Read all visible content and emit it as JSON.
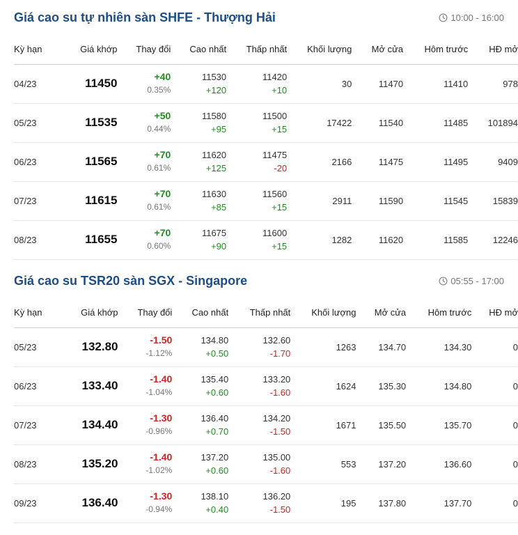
{
  "colors": {
    "title": "#1d4e89",
    "up": "#1e8f1e",
    "down": "#d22323"
  },
  "shfe": {
    "title": "Giá cao su tự nhiên sàn SHFE - Thượng Hải",
    "time_icon": "clock-icon",
    "time": "10:00 - 16:00",
    "headers": [
      "Kỳ hạn",
      "Giá khớp",
      "Thay đổi",
      "Cao nhất",
      "Thấp nhất",
      "Khối lượng",
      "Mở cửa",
      "Hôm trước",
      "HĐ mở"
    ],
    "rows": [
      {
        "term": "04/23",
        "price": "11450",
        "change": "+40",
        "change_pct": "0.35%",
        "dir": "up",
        "high": "11530",
        "high_chg": "+120",
        "high_dir": "up",
        "low": "11420",
        "low_chg": "+10",
        "low_dir": "up",
        "volume": "30",
        "open": "11470",
        "prev": "11410",
        "oi": "978"
      },
      {
        "term": "05/23",
        "price": "11535",
        "change": "+50",
        "change_pct": "0.44%",
        "dir": "up",
        "high": "11580",
        "high_chg": "+95",
        "high_dir": "up",
        "low": "11500",
        "low_chg": "+15",
        "low_dir": "up",
        "volume": "17422",
        "open": "11540",
        "prev": "11485",
        "oi": "101894"
      },
      {
        "term": "06/23",
        "price": "11565",
        "change": "+70",
        "change_pct": "0.61%",
        "dir": "up",
        "high": "11620",
        "high_chg": "+125",
        "high_dir": "up",
        "low": "11475",
        "low_chg": "-20",
        "low_dir": "down",
        "volume": "2166",
        "open": "11475",
        "prev": "11495",
        "oi": "9409"
      },
      {
        "term": "07/23",
        "price": "11615",
        "change": "+70",
        "change_pct": "0.61%",
        "dir": "up",
        "high": "11630",
        "high_chg": "+85",
        "high_dir": "up",
        "low": "11560",
        "low_chg": "+15",
        "low_dir": "up",
        "volume": "2911",
        "open": "11590",
        "prev": "11545",
        "oi": "15839"
      },
      {
        "term": "08/23",
        "price": "11655",
        "change": "+70",
        "change_pct": "0.60%",
        "dir": "up",
        "high": "11675",
        "high_chg": "+90",
        "high_dir": "up",
        "low": "11600",
        "low_chg": "+15",
        "low_dir": "up",
        "volume": "1282",
        "open": "11620",
        "prev": "11585",
        "oi": "12246"
      }
    ]
  },
  "sgx": {
    "title": "Giá cao su TSR20 sàn SGX - Singapore",
    "time_icon": "clock-icon",
    "time": "05:55 - 17:00",
    "headers": [
      "Kỳ hạn",
      "Giá khớp",
      "Thay đổi",
      "Cao nhất",
      "Thấp nhất",
      "Khối lượng",
      "Mở cửa",
      "Hôm trước",
      "HĐ mở"
    ],
    "rows": [
      {
        "term": "05/23",
        "price": "132.80",
        "change": "-1.50",
        "change_pct": "-1.12%",
        "dir": "down",
        "high": "134.80",
        "high_chg": "+0.50",
        "high_dir": "up",
        "low": "132.60",
        "low_chg": "-1.70",
        "low_dir": "down",
        "volume": "1263",
        "open": "134.70",
        "prev": "134.30",
        "oi": "0"
      },
      {
        "term": "06/23",
        "price": "133.40",
        "change": "-1.40",
        "change_pct": "-1.04%",
        "dir": "down",
        "high": "135.40",
        "high_chg": "+0.60",
        "high_dir": "up",
        "low": "133.20",
        "low_chg": "-1.60",
        "low_dir": "down",
        "volume": "1624",
        "open": "135.30",
        "prev": "134.80",
        "oi": "0"
      },
      {
        "term": "07/23",
        "price": "134.40",
        "change": "-1.30",
        "change_pct": "-0.96%",
        "dir": "down",
        "high": "136.40",
        "high_chg": "+0.70",
        "high_dir": "up",
        "low": "134.20",
        "low_chg": "-1.50",
        "low_dir": "down",
        "volume": "1671",
        "open": "135.50",
        "prev": "135.70",
        "oi": "0"
      },
      {
        "term": "08/23",
        "price": "135.20",
        "change": "-1.40",
        "change_pct": "-1.02%",
        "dir": "down",
        "high": "137.20",
        "high_chg": "+0.60",
        "high_dir": "up",
        "low": "135.00",
        "low_chg": "-1.60",
        "low_dir": "down",
        "volume": "553",
        "open": "137.20",
        "prev": "136.60",
        "oi": "0"
      },
      {
        "term": "09/23",
        "price": "136.40",
        "change": "-1.30",
        "change_pct": "-0.94%",
        "dir": "down",
        "high": "138.10",
        "high_chg": "+0.40",
        "high_dir": "up",
        "low": "136.20",
        "low_chg": "-1.50",
        "low_dir": "down",
        "volume": "195",
        "open": "137.80",
        "prev": "137.70",
        "oi": "0"
      }
    ]
  }
}
